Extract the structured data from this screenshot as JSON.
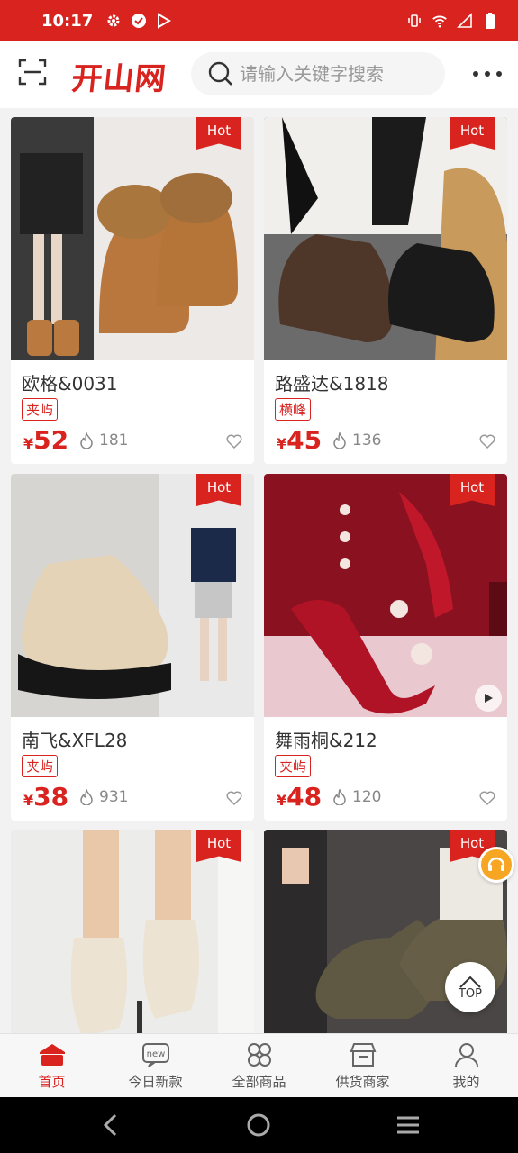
{
  "status_bar": {
    "time": "10:17"
  },
  "header": {
    "logo_text": "开山网",
    "search_placeholder": "请输入关键字搜索"
  },
  "products": [
    {
      "title": "欧格&0031",
      "location": "夹屿",
      "currency": "¥",
      "price": "52",
      "heat": "181",
      "tag": "Hot"
    },
    {
      "title": "路盛达&1818",
      "location": "横峰",
      "currency": "¥",
      "price": "45",
      "heat": "136",
      "tag": "Hot"
    },
    {
      "title": "南飞&XFL28",
      "location": "夹屿",
      "currency": "¥",
      "price": "38",
      "heat": "931",
      "tag": "Hot"
    },
    {
      "title": "舞雨桐&212",
      "location": "夹屿",
      "currency": "¥",
      "price": "48",
      "heat": "120",
      "tag": "Hot"
    },
    {
      "tag": "Hot"
    },
    {
      "tag": "Hot"
    }
  ],
  "top_button_label": "TOP",
  "bottom_nav": [
    {
      "label": "首页",
      "icon": "home-icon",
      "active": true
    },
    {
      "label": "今日新款",
      "icon": "new-icon",
      "active": false
    },
    {
      "label": "全部商品",
      "icon": "all-products-icon",
      "active": false
    },
    {
      "label": "供货商家",
      "icon": "store-icon",
      "active": false
    },
    {
      "label": "我的",
      "icon": "profile-icon",
      "active": false
    }
  ],
  "colors": {
    "brand": "#d8231f",
    "accent": "#f6a623"
  }
}
